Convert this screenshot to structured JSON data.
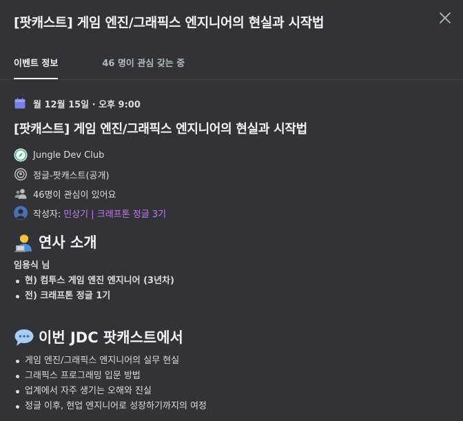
{
  "modal": {
    "title": "[팟캐스트] 게임 엔진/그래픽스 엔지니어의 현실과 시작법",
    "close_icon": "close-icon"
  },
  "tabs": [
    {
      "label": "이벤트 정보",
      "active": true
    },
    {
      "label": "46 명이 관심 갖는 중",
      "active": false
    }
  ],
  "event": {
    "date": "월 12월 15일 · 오후 9:00",
    "title": "[팟캐스트] 게임 엔진/그래픽스 엔지니어의 현실과 시작법",
    "server": "Jungle Dev Club",
    "channel": "정글-팟캐스트(공개)",
    "interested": "46명이 관심이 있어요",
    "author_label": "작성자:",
    "author_name": "민상기 | 크래프톤 정글 3기",
    "icons": {
      "date": "calendar-icon",
      "server": "server-compass-icon",
      "channel": "stage-channel-icon",
      "interested": "people-icon",
      "author": "avatar"
    }
  },
  "speaker_section": {
    "heading": "연사 소개",
    "emoji": "technologist-emoji",
    "name": "임용식 님",
    "items": [
      "현) 컴투스 게임 엔진 엔지니어 (3년차)",
      "전) 크래프톤 정글 1기"
    ]
  },
  "podcast_section": {
    "heading": "이번 JDC 팟캐스트에서",
    "emoji": "speech-balloon-emoji",
    "items": [
      "게임 엔진/그래픽스 엔지니어의 실무 현실",
      "그래픽스 프로그래밍 입문 방법",
      "업계에서 자주 생기는 오해와 진실",
      "정글 이후, 현업 엔지니어로 성장하기까지의 여정"
    ]
  },
  "colors": {
    "background": "#313338",
    "accent_link": "#c27cf0",
    "calendar_icon": "#7a7fe6"
  }
}
